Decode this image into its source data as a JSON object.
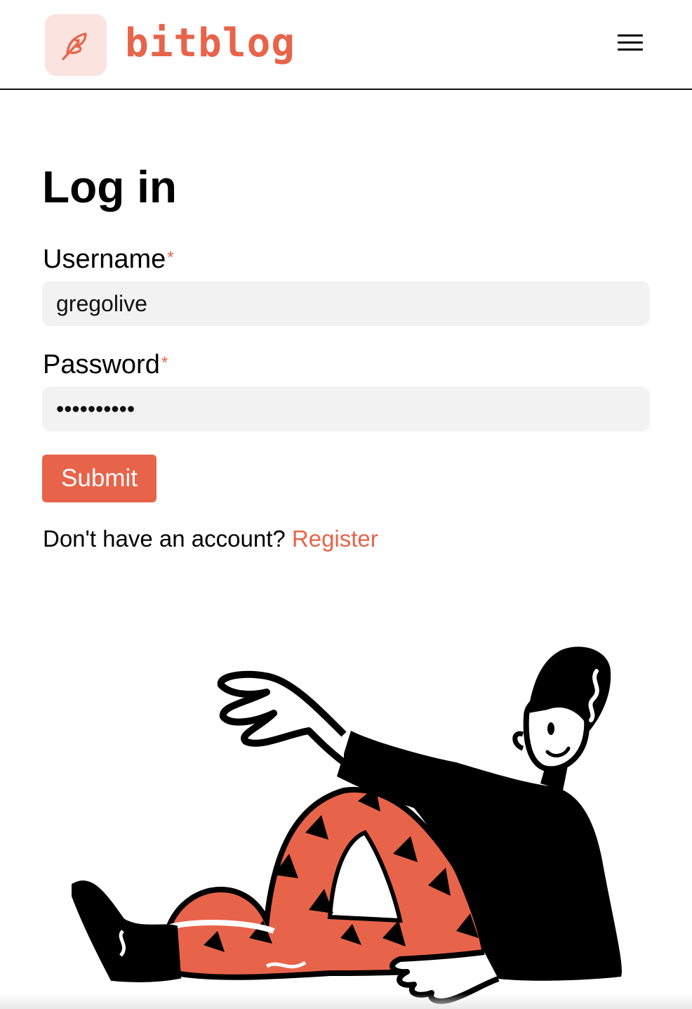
{
  "header": {
    "brand": "bitblog",
    "logo_icon": "feather-icon",
    "menu_icon": "hamburger-menu-icon"
  },
  "form": {
    "title": "Log in",
    "username": {
      "label": "Username",
      "required_mark": "*",
      "value": "gregolive"
    },
    "password": {
      "label": "Password",
      "required_mark": "*",
      "value": "••••••••••"
    },
    "submit_label": "Submit",
    "register_prompt": "Don't have an account?",
    "register_link": "Register"
  },
  "colors": {
    "accent": "#e7644a",
    "logo_bg": "#fbe3df",
    "input_bg": "#f2f2f2"
  },
  "illustration": "person-reclining-illustration"
}
